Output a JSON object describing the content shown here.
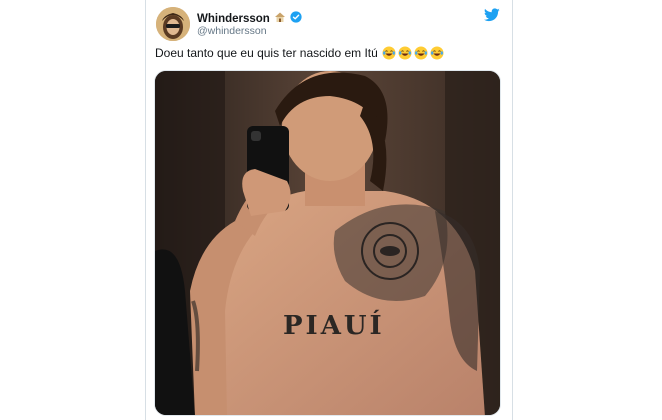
{
  "tweet": {
    "display_name": "Whindersson",
    "handle": "@whindersson",
    "text": "Doeu tanto que eu quis ter nascido em Itú",
    "emojis": [
      "face-with-tears-of-joy",
      "face-with-tears-of-joy",
      "face-with-tears-of-joy",
      "face-with-tears-of-joy"
    ],
    "media": {
      "tattoo_text": "PIAUÍ"
    }
  },
  "colors": {
    "twitter_blue": "#1da1f2",
    "verified_blue": "#1da1f2",
    "text_primary": "#14171a",
    "text_secondary": "#657786"
  },
  "icons": {
    "brand": "twitter-bird-icon",
    "verified": "verified-badge-icon",
    "house": "house-emoji-icon"
  }
}
